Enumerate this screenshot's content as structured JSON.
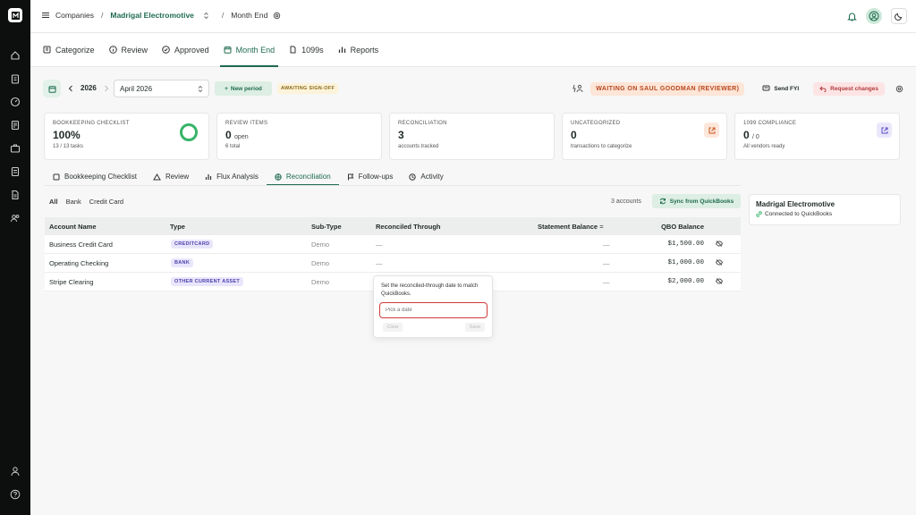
{
  "breadcrumb": {
    "root": "Companies",
    "company": "Madrigal Electromotive",
    "page": "Month End"
  },
  "nav_tabs": [
    {
      "label": "Categorize",
      "icon": "categorize-icon"
    },
    {
      "label": "Review",
      "icon": "info-icon"
    },
    {
      "label": "Approved",
      "icon": "check-circle-icon"
    },
    {
      "label": "Month End",
      "icon": "calendar-icon",
      "active": true
    },
    {
      "label": "1099s",
      "icon": "document-icon"
    },
    {
      "label": "Reports",
      "icon": "bar-chart-icon"
    }
  ],
  "period": {
    "year": "2026",
    "month": "April 2026",
    "new_period": "New period",
    "status": "AWAITING SIGN-OFF",
    "waiting": "WAITING ON SAUL GOODMAN (REVIEWER)",
    "send_fyi": "Send FYI",
    "request_changes": "Request changes"
  },
  "cards": [
    {
      "label": "BOOKKEEPING CHECKLIST",
      "value": "100%",
      "value_suffix": "",
      "sub": "13 / 13 tasks",
      "progress": 1.0
    },
    {
      "label": "REVIEW ITEMS",
      "value": "0",
      "value_suffix": "open",
      "sub": "6 total"
    },
    {
      "label": "RECONCILIATION",
      "value": "3",
      "value_suffix": "",
      "sub": "accounts tracked"
    },
    {
      "label": "UNCATEGORIZED",
      "value": "0",
      "value_suffix": "",
      "sub": "transactions to categorize"
    },
    {
      "label": "1099 COMPLIANCE",
      "value": "0",
      "value_suffix": "/ 0",
      "sub": "All vendors ready"
    }
  ],
  "sub_tabs": [
    {
      "label": "Bookkeeping Checklist"
    },
    {
      "label": "Review"
    },
    {
      "label": "Flux Analysis"
    },
    {
      "label": "Reconciliation",
      "active": true
    },
    {
      "label": "Follow-ups"
    },
    {
      "label": "Activity"
    }
  ],
  "filters": [
    "All",
    "Bank",
    "Credit Card"
  ],
  "account_count": "3 accounts",
  "sync_label": "Sync from QuickBooks",
  "table": {
    "headers": [
      "Account Name",
      "Type",
      "Sub-Type",
      "Reconciled Through",
      "Statement Balance",
      "QBO Balance"
    ],
    "rows": [
      {
        "name": "Business Credit Card",
        "type": "CREDITCARD",
        "subtype": "Demo",
        "reconciled": "—",
        "statement": "—",
        "qbo": "$1,500.00"
      },
      {
        "name": "Operating Checking",
        "type": "BANK",
        "subtype": "Demo",
        "reconciled": "—",
        "statement": "—",
        "qbo": "$1,000.00"
      },
      {
        "name": "Stripe Clearing",
        "type": "OTHER CURRENT ASSET",
        "subtype": "Demo",
        "reconciled": "",
        "statement": "—",
        "qbo": "$2,000.00"
      }
    ]
  },
  "popover": {
    "text": "Set the reconciled-through date to match QuickBooks.",
    "placeholder": "Pick a date",
    "clear": "Clear",
    "save": "Save"
  },
  "entity": {
    "name": "Madrigal Electromotive",
    "status": "Connected to QuickBooks"
  }
}
